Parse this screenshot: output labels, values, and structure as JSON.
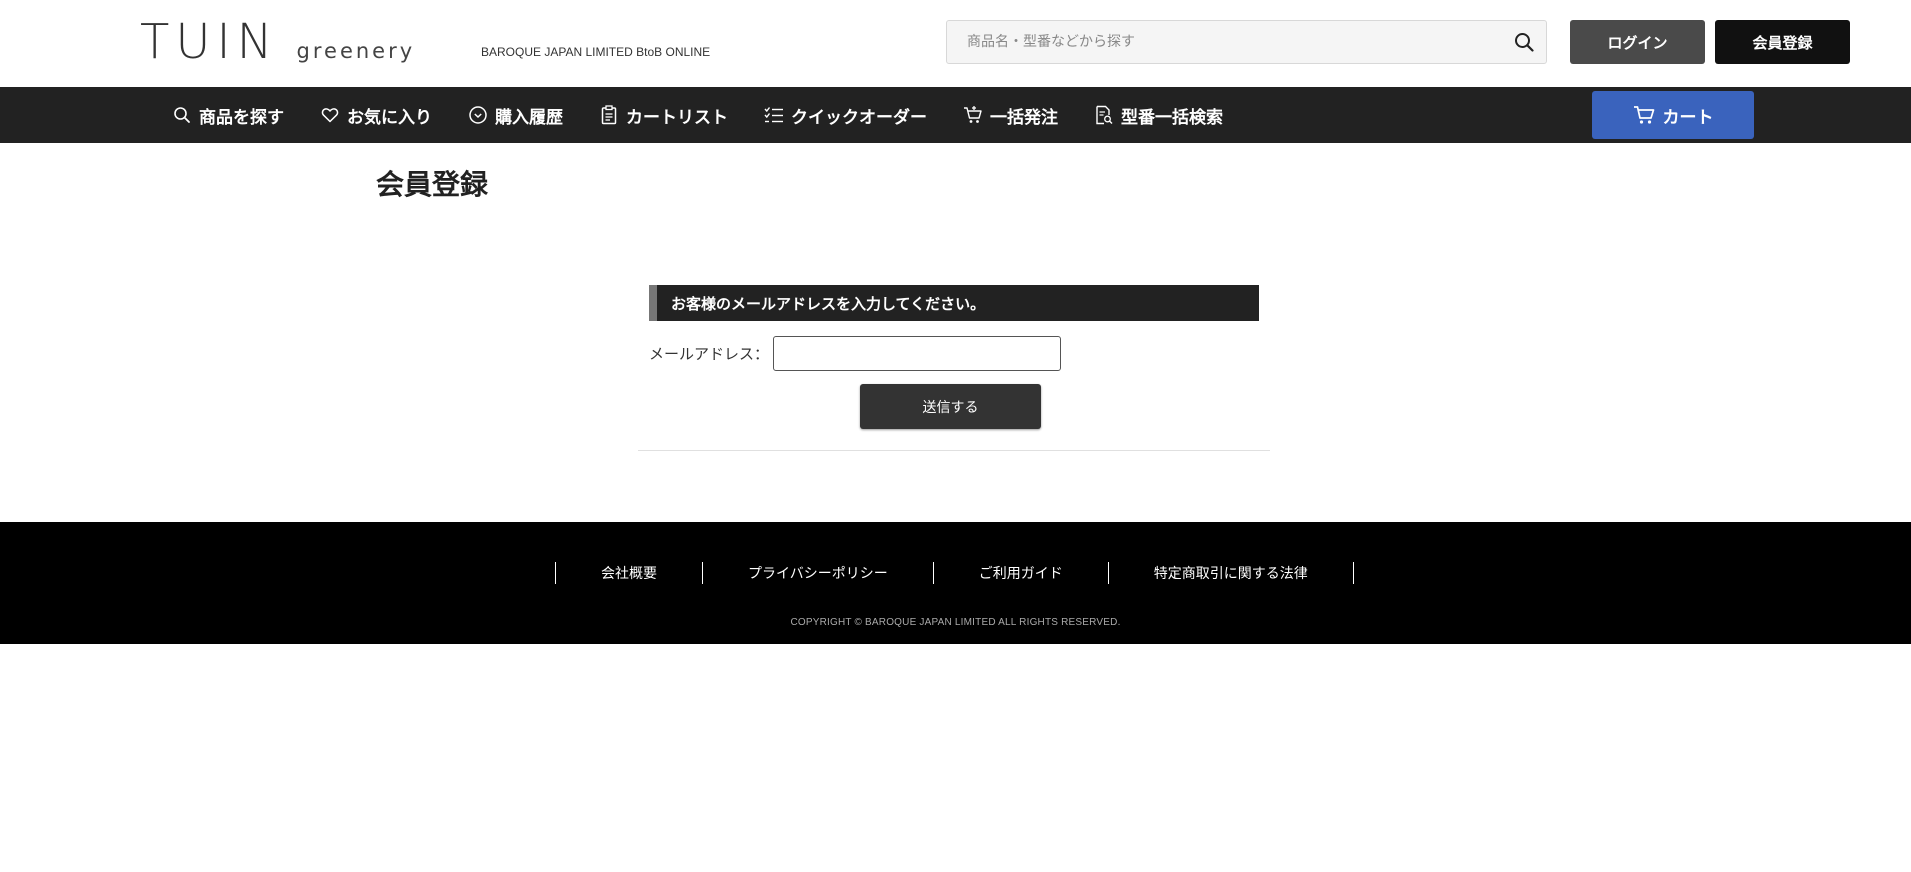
{
  "header": {
    "logo_main": "TUIN",
    "logo_sub": "greenery",
    "tagline": "BAROQUE JAPAN LIMITED BtoB ONLINE",
    "search_placeholder": "商品名・型番などから探す",
    "login_label": "ログイン",
    "register_label": "会員登録"
  },
  "nav": {
    "items": [
      {
        "label": "商品を探す",
        "icon": "search-icon"
      },
      {
        "label": "お気に入り",
        "icon": "heart-icon"
      },
      {
        "label": "購入履歴",
        "icon": "clock-icon"
      },
      {
        "label": "カートリスト",
        "icon": "clipboard-icon"
      },
      {
        "label": "クイックオーダー",
        "icon": "checklist-icon"
      },
      {
        "label": "一括発注",
        "icon": "cart-plus-icon"
      },
      {
        "label": "型番一括検索",
        "icon": "document-search-icon"
      }
    ],
    "cart_label": "カート"
  },
  "main": {
    "page_title": "会員登録",
    "form_heading": "お客様のメールアドレスを入力してください。",
    "email_label": "メールアドレス：",
    "email_value": "",
    "submit_label": "送信する"
  },
  "footer": {
    "links": [
      "会社概要",
      "プライバシーポリシー",
      "ご利用ガイド",
      "特定商取引に関する法律"
    ],
    "copyright": "COPYRIGHT © BAROQUE JAPAN LIMITED ALL RIGHTS RESERVED."
  },
  "colors": {
    "nav_bg": "#222222",
    "cart_blue": "#3a63bd",
    "footer_bg": "#000000",
    "login_bg": "#4a4a4a"
  }
}
